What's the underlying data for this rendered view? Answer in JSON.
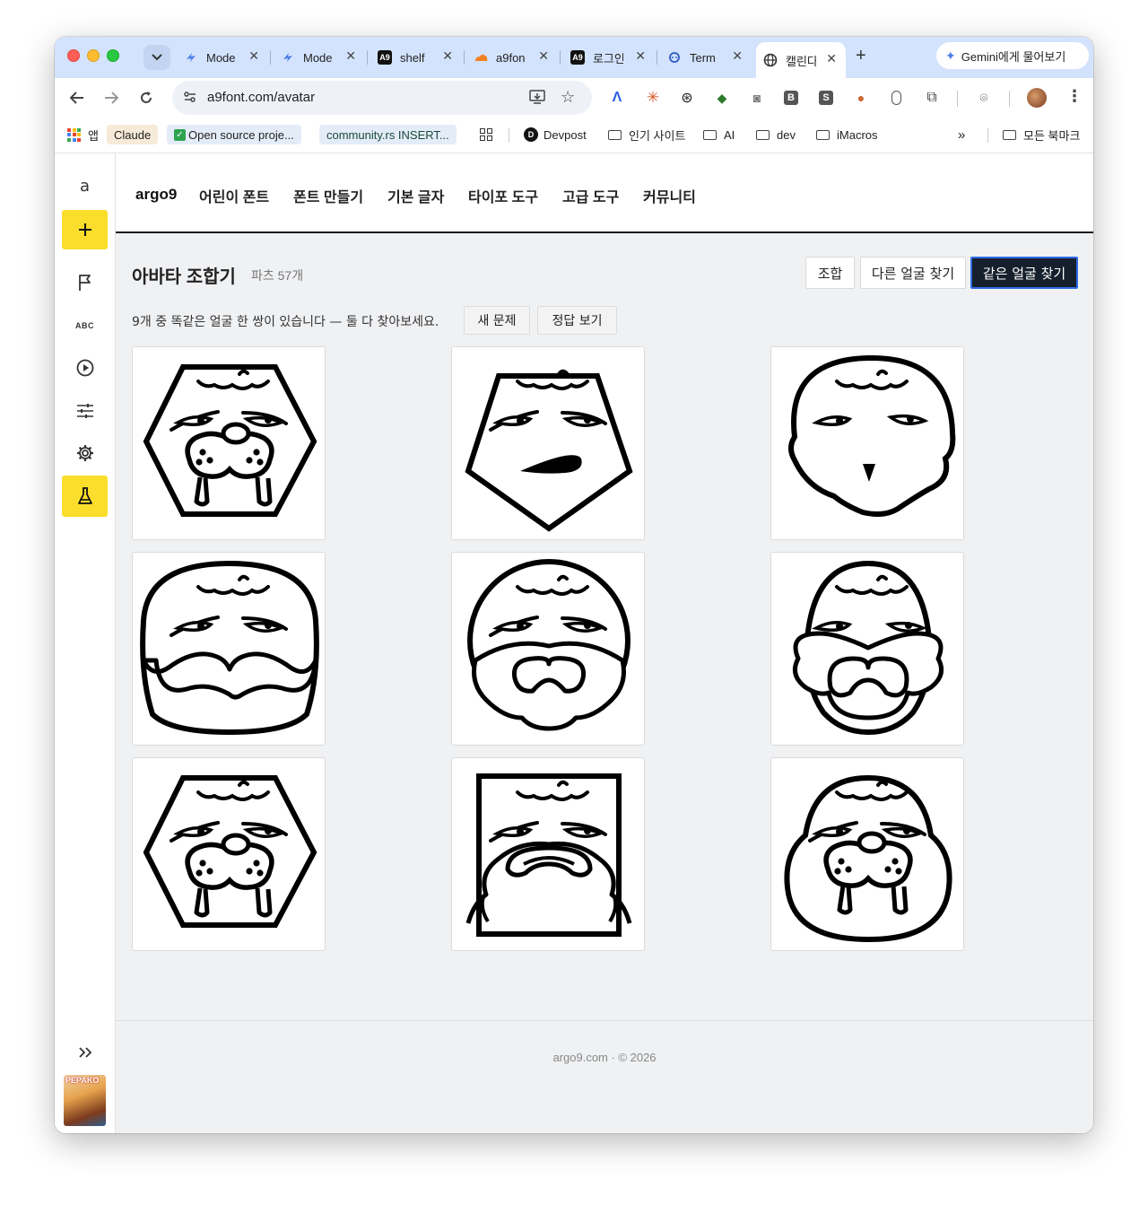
{
  "browser": {
    "tabs": [
      {
        "label": "Mode",
        "icon": "spark-icon"
      },
      {
        "label": "Mode",
        "icon": "spark-icon"
      },
      {
        "label": "shelf",
        "icon": "a9-icon"
      },
      {
        "label": "a9fon",
        "icon": "cloudflare-icon"
      },
      {
        "label": "로그인",
        "icon": "a9-icon"
      },
      {
        "label": "Term",
        "icon": "robot-icon"
      },
      {
        "label": "캘린다",
        "icon": "globe-icon"
      }
    ],
    "gemini_label": "Gemini에게 물어보기",
    "url": "a9font.com/avatar",
    "bookmarks": {
      "apps": "앱",
      "claude": "Claude",
      "open_source": "Open source proje...",
      "community": "community.rs INSERT...",
      "devpost": "Devpost",
      "popular": "인기 사이트",
      "ai": "AI",
      "dev": "dev",
      "imacros": "iMacros",
      "more": "»",
      "all": "모든 북마크"
    }
  },
  "sidebar": {
    "a_label": "a",
    "abc_label": "ABC",
    "thumb_label": "PEPAKO"
  },
  "nav": {
    "brand": "argo9",
    "items": [
      "어린이 폰트",
      "폰트 만들기",
      "기본 글자",
      "타이포 도구",
      "고급 도구",
      "커뮤니티"
    ]
  },
  "main": {
    "title": "아바타 조합기",
    "parts_count": "파츠 57개",
    "modes": [
      "조합",
      "다른 얼굴 찾기",
      "같은 얼굴 찾기"
    ],
    "active_mode": "같은 얼굴 찾기",
    "instruction": "9개 중 똑같은 얼굴 한 쌍이 있습니다 — 둘 다 찾아보세요.",
    "new_puzzle": "새 문제",
    "show_answer": "정답 보기",
    "faces": [
      {
        "shape": "hexagon",
        "feature": "walrus"
      },
      {
        "shape": "pentagon",
        "feature": "open-mouth"
      },
      {
        "shape": "skull",
        "feature": "beak"
      },
      {
        "shape": "round-rect",
        "feature": "mustache"
      },
      {
        "shape": "circle",
        "feature": "beard"
      },
      {
        "shape": "egg",
        "feature": "beard"
      },
      {
        "shape": "hexagon",
        "feature": "walrus"
      },
      {
        "shape": "rect",
        "feature": "beard-mustache"
      },
      {
        "shape": "round",
        "feature": "walrus"
      }
    ]
  },
  "footer": {
    "text": "argo9.com · © 2026"
  },
  "colors": {
    "accent_yellow": "#fbde2b",
    "primary_dark": "#16202d",
    "tab_strip": "#d3e3fd"
  }
}
